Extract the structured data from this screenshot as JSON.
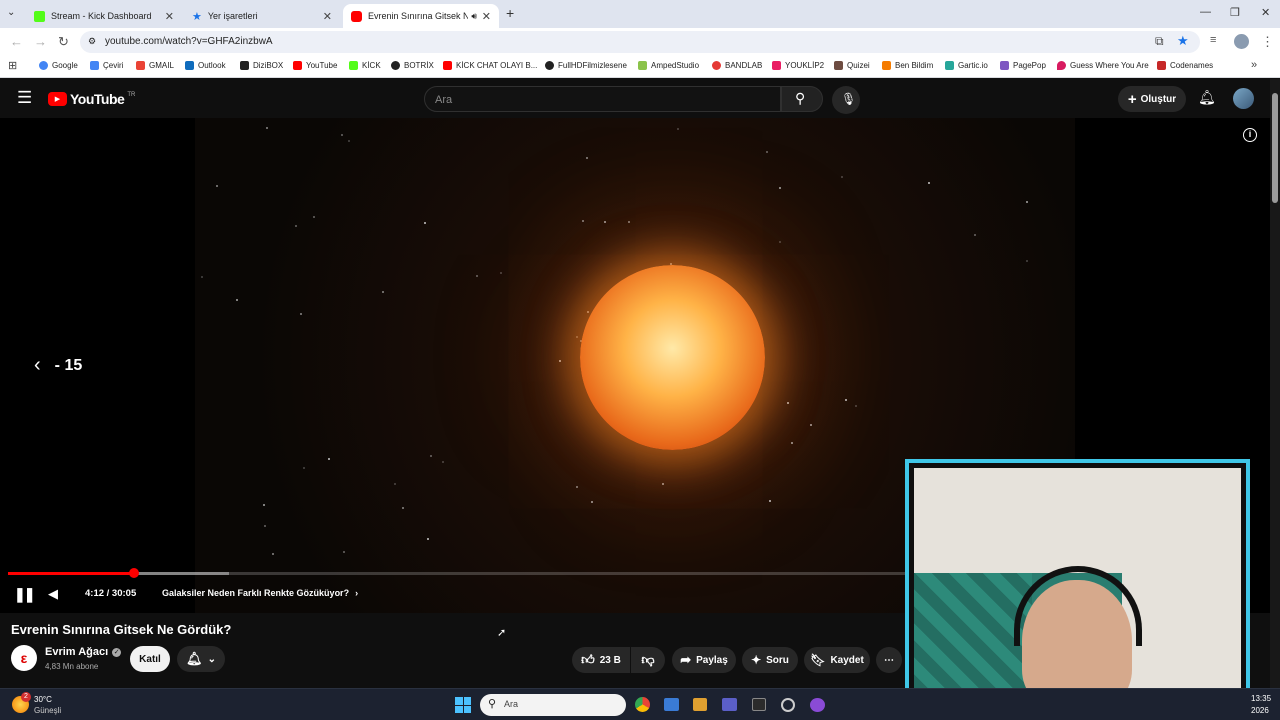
{
  "browser": {
    "tabs": [
      {
        "label": "Stream - Kick Dashboard",
        "favicon_color": "#53fc18",
        "active": false
      },
      {
        "label": "Yer işaretleri",
        "active": false
      },
      {
        "label": "Evrenin Sınırına Gitsek Ne Gö",
        "favicon_color": "#ff0000",
        "active": true
      }
    ],
    "new_tab_symbol": "+",
    "url": "youtube.com/watch?v=GHFA2inzbwA"
  },
  "bookmarks": [
    {
      "label": "Google",
      "color": "#4285f4"
    },
    {
      "label": "Çeviri",
      "color": "#4285f4"
    },
    {
      "label": "GMAIL",
      "color": "#ea4335"
    },
    {
      "label": "Outlook",
      "color": "#0f6cbd"
    },
    {
      "label": "DiziBOX",
      "color": "#222222"
    },
    {
      "label": "YouTube",
      "color": "#ff0000"
    },
    {
      "label": "KİCK",
      "color": "#53fc18"
    },
    {
      "label": "BOTRİX",
      "color": "#222222"
    },
    {
      "label": "KİCK CHAT OLAYI B...",
      "color": "#ff0000"
    },
    {
      "label": "FullHDFilmizlesene",
      "color": "#222222"
    },
    {
      "label": "AmpedStudio",
      "color": "#8bc34a"
    },
    {
      "label": "BANDLAB",
      "color": "#e53935"
    },
    {
      "label": "YOUKLİP2",
      "color": "#e91e63"
    },
    {
      "label": "Quizei",
      "color": "#6d4c41"
    },
    {
      "label": "Ben Bildim",
      "color": "#f57c00"
    },
    {
      "label": "Gartic.io",
      "color": "#26a69a"
    },
    {
      "label": "PagePop",
      "color": "#7e57c2"
    },
    {
      "label": "Guess Where You Are",
      "color": "#d81b60"
    },
    {
      "label": "Codenames",
      "color": "#c62828"
    }
  ],
  "youtube": {
    "logo": "YouTube",
    "region": "TR",
    "search_placeholder": "Ara",
    "create_label": "Oluştur"
  },
  "player": {
    "seek_indicator": "- 15",
    "time": "4:12 / 30:05",
    "chapter": "Galaksiler Neden Farklı Renkte Gözüküyor?",
    "progress_fraction": 0.14,
    "buffered_fraction": 0.245
  },
  "video": {
    "title": "Evrenin Sınırına Gitsek Ne Gördük?",
    "channel": "Evrim Ağacı",
    "subscribers": "4,83 Mn abone",
    "join_label": "Katıl",
    "likes": "23 B",
    "share_label": "Paylaş",
    "ask_label": "Soru",
    "save_label": "Kaydet"
  },
  "taskbar": {
    "temperature": "30°C",
    "weather": "Güneşli",
    "weather_badge": "2",
    "search_placeholder": "Ara",
    "time": "13:35",
    "date": "2026"
  }
}
